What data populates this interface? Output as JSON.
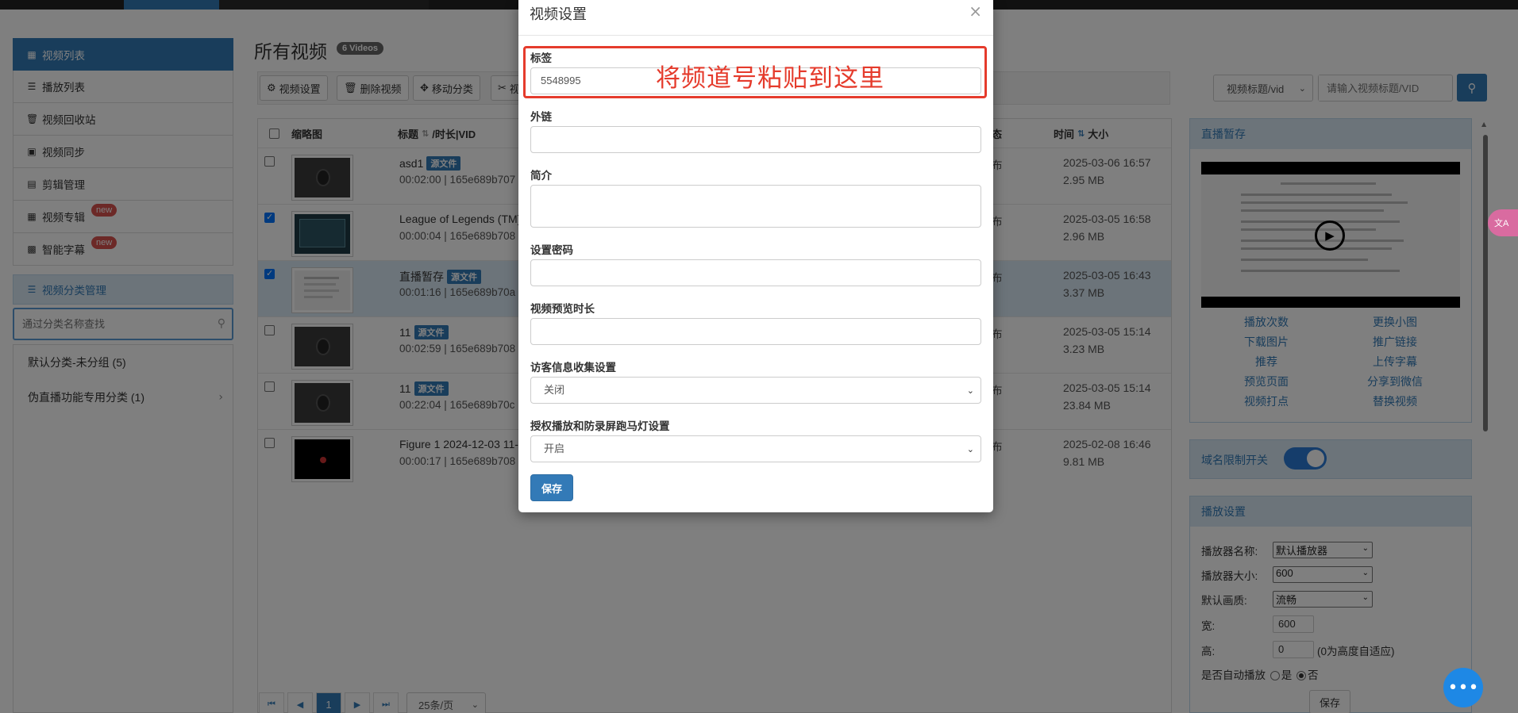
{
  "sidebar": {
    "items": [
      {
        "label": "视频列表",
        "icon": "film-icon",
        "active": true
      },
      {
        "label": "播放列表",
        "icon": "list-icon"
      },
      {
        "label": "视频回收站",
        "icon": "trash-icon"
      },
      {
        "label": "视频同步",
        "icon": "sync-icon"
      },
      {
        "label": "剪辑管理",
        "icon": "edit-icon"
      },
      {
        "label": "视频专辑",
        "icon": "grid-icon",
        "badge": "new"
      },
      {
        "label": "智能字幕",
        "icon": "caption-icon",
        "badge": "new"
      }
    ],
    "category_title": "视频分类管理",
    "category_search_placeholder": "通过分类名称查找",
    "categories": [
      {
        "label": "默认分类-未分组 (5)"
      },
      {
        "label": "伪直播功能专用分类 (1)",
        "has_children": true
      }
    ]
  },
  "main": {
    "title": "所有视频",
    "count_badge": "6 Videos",
    "toolbar": {
      "buttons": [
        {
          "label": "视频设置",
          "icon": "gear-icon"
        },
        {
          "label": "删除视频",
          "icon": "trash-icon"
        },
        {
          "label": "移动分类",
          "icon": "move-icon"
        },
        {
          "label": "视",
          "icon": "scissors-icon"
        }
      ],
      "search_type": "视频标题/vid",
      "search_placeholder": "请输入视频标题/VID"
    },
    "table": {
      "headers": {
        "thumb": "缩略图",
        "title": "标题",
        "title_sub": "/时长|VID",
        "status": "态",
        "time": "时间",
        "size": "大小"
      },
      "rows": [
        {
          "checked": false,
          "title": "asd1",
          "badge": "源文件",
          "meta": "00:02:00 | 165e689b707",
          "status": "布",
          "time": "2025-03-06 16:57",
          "size": "2.95 MB",
          "thumb": "face"
        },
        {
          "checked": true,
          "title": "League of Legends (TM)",
          "badge": "",
          "meta": "00:00:04 | 165e689b708",
          "status": "布",
          "time": "2025-03-05 16:58",
          "size": "2.96 MB",
          "thumb": "game"
        },
        {
          "checked": true,
          "title": "直播暂存",
          "badge": "源文件",
          "meta": "00:01:16 | 165e689b70a",
          "status": "布",
          "time": "2025-03-05 16:43",
          "size": "3.37 MB",
          "thumb": "doc",
          "selected": true
        },
        {
          "checked": false,
          "title": "11",
          "badge": "源文件",
          "meta": "00:02:59 | 165e689b708",
          "status": "布",
          "time": "2025-03-05 15:14",
          "size": "3.23 MB",
          "thumb": "face"
        },
        {
          "checked": false,
          "title": "11",
          "badge": "源文件",
          "meta": "00:22:04 | 165e689b70c",
          "status": "布",
          "time": "2025-03-05 15:14",
          "size": "23.84 MB",
          "thumb": "face"
        },
        {
          "checked": false,
          "title": "Figure 1 2024-12-03 11-",
          "badge": "",
          "meta": "00:00:17 | 165e689b708",
          "status": "布",
          "time": "2025-02-08 16:46",
          "size": "9.81 MB",
          "thumb": "dark"
        }
      ]
    },
    "pager": {
      "current": "1",
      "page_size": "25条/页"
    }
  },
  "right_panel": {
    "live_title": "直播暂存",
    "links": [
      "播放次数",
      "更换小图",
      "下载图片",
      "推广链接",
      "推荐",
      "上传字幕",
      "预览页面",
      "分享到微信",
      "视频打点",
      "替换视频"
    ],
    "domain_limit_label": "域名限制开关",
    "play_settings_title": "播放设置",
    "player_name_label": "播放器名称:",
    "player_name_value": "默认播放器",
    "player_size_label": "播放器大小:",
    "player_size_value": "600",
    "quality_label": "默认画质:",
    "quality_value": "流畅",
    "width_label": "宽:",
    "width_value": "600",
    "height_label": "高:",
    "height_value": "0",
    "height_hint": "(0为高度自适应)",
    "autoplay_label": "是否自动播放",
    "autoplay_yes": "是",
    "autoplay_no": "否",
    "save_label": "保存"
  },
  "modal": {
    "title": "视频设置",
    "tag_label": "标签",
    "tag_value": "5548995",
    "annotation": "将频道号粘贴到这里",
    "link_label": "外链",
    "intro_label": "简介",
    "password_label": "设置密码",
    "preview_label": "视频预览时长",
    "visitor_label": "访客信息收集设置",
    "visitor_value": "关闭",
    "auth_label": "授权播放和防录屏跑马灯设置",
    "auth_value": "开启",
    "save_label": "保存",
    "close_icon": "×"
  },
  "colors": {
    "accent": "#337ab7",
    "annotation": "#e53b2c",
    "overlay": "rgba(0,0,0,0.5)"
  }
}
